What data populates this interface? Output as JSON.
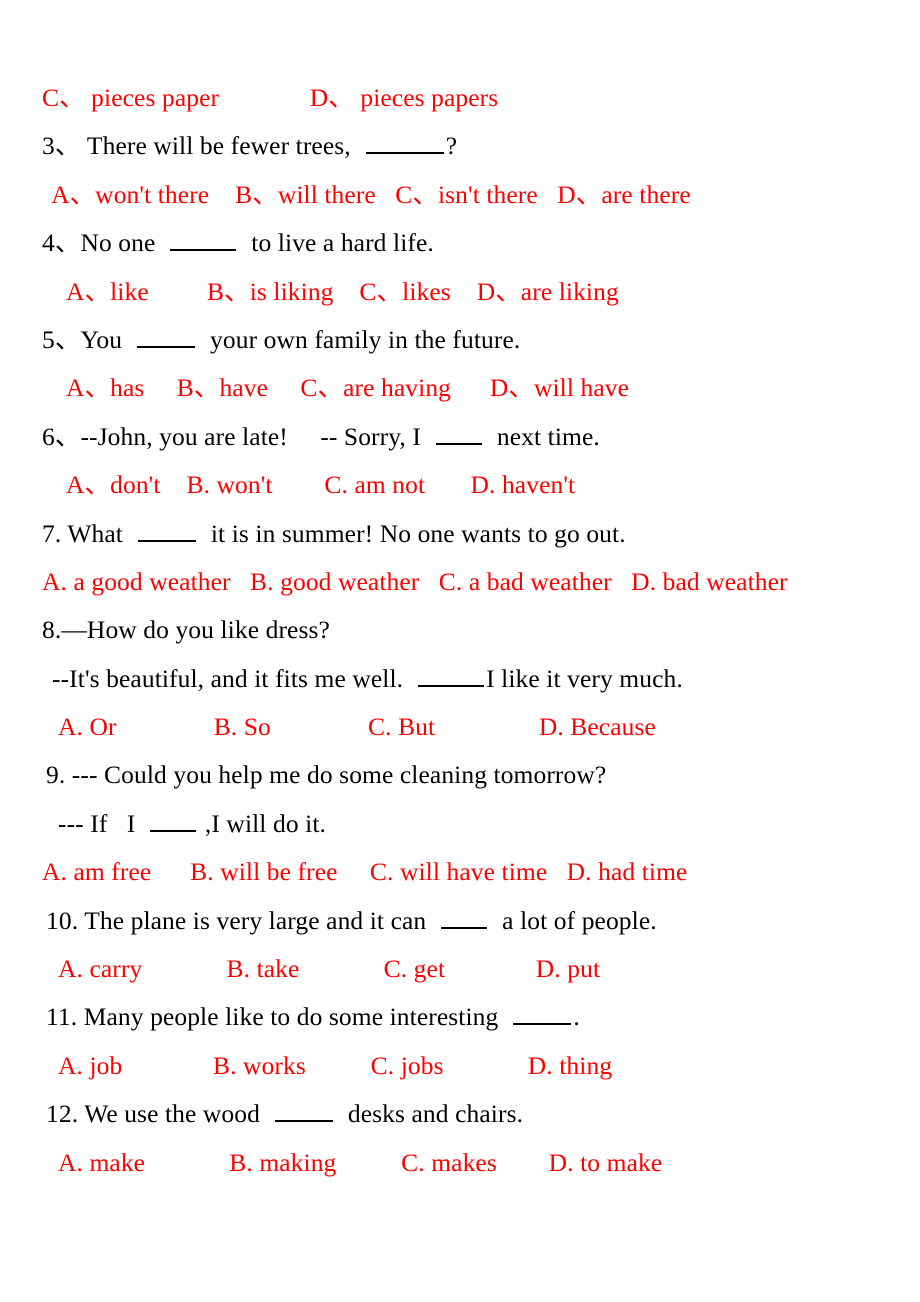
{
  "document": {
    "type": "multiple-choice-worksheet",
    "subject": "English grammar",
    "question_text_color": "#000000",
    "option_text_color": "#ff0000",
    "background_color": "#ffffff"
  },
  "lines": [
    {
      "id": "q2-options-cd",
      "kind": "options",
      "indent": 0,
      "text": "C、 pieces paper              D、 pieces papers"
    },
    {
      "id": "q3-stem",
      "kind": "question",
      "indent": 0,
      "number": "3、",
      "text_before": "3、 There will be fewer trees,  ",
      "blank": "xl",
      "text_after": "?"
    },
    {
      "id": "q3-options",
      "kind": "options",
      "indent": 1,
      "text": " A、won't there    B、will there   C、isn't there   D、are there"
    },
    {
      "id": "q4-stem",
      "kind": "question",
      "indent": 0,
      "number": "4、",
      "text_before": "4、No one  ",
      "blank": "lg",
      "text_after": "  to live a hard life."
    },
    {
      "id": "q4-options",
      "kind": "options",
      "indent": 4,
      "text": "A、like         B、is liking    C、likes    D、are liking"
    },
    {
      "id": "q5-stem",
      "kind": "question",
      "indent": 0,
      "number": "5、",
      "text_before": "5、You  ",
      "blank": "md",
      "text_after": "  your own family in the future."
    },
    {
      "id": "q5-options",
      "kind": "options",
      "indent": 4,
      "text": "A、has     B、have     C、are having      D、will have"
    },
    {
      "id": "q6-stem",
      "kind": "question",
      "indent": 0,
      "number": "6、",
      "text_before": "6、--John, you are late!     -- Sorry, I  ",
      "blank": "sm",
      "text_after": "  next time."
    },
    {
      "id": "q6-options",
      "kind": "options",
      "indent": 4,
      "text": "A、don't    B. won't        C. am not       D. haven't"
    },
    {
      "id": "q7-stem",
      "kind": "question",
      "indent": 0,
      "number": "7.",
      "text_before": "7. What  ",
      "blank": "md",
      "text_after": "  it is in summer! No one wants to go out."
    },
    {
      "id": "q7-options",
      "kind": "options",
      "indent": 0,
      "text": "A. a good weather   B. good weather   C. a bad weather   D. bad weather"
    },
    {
      "id": "q8-stem-1",
      "kind": "question",
      "indent": 0,
      "number": "8.",
      "text_before": "8.—How do you like dress?",
      "blank": null,
      "text_after": ""
    },
    {
      "id": "q8-stem-2",
      "kind": "question",
      "indent": 2,
      "text_before": "--It's beautiful, and it fits me well.  ",
      "blank": "lg",
      "text_after": "I like it very much."
    },
    {
      "id": "q8-options",
      "kind": "options",
      "indent": 3,
      "text": "A. Or               B. So               C. But                D. Because"
    },
    {
      "id": "q9-stem-1",
      "kind": "question",
      "indent": 1,
      "number": "9.",
      "text_before": "9. --- Could you help me do some cleaning tomorrow?",
      "blank": null,
      "text_after": ""
    },
    {
      "id": "q9-stem-2",
      "kind": "question",
      "indent": 3,
      "text_before": "--- If   I  ",
      "blank": "sm",
      "text_after": " ,I will do it."
    },
    {
      "id": "q9-options",
      "kind": "options",
      "indent": 0,
      "text": "A. am free      B. will be free     C. will have time   D. had time"
    },
    {
      "id": "q10-stem",
      "kind": "question",
      "indent": 1,
      "number": "10.",
      "text_before": "10. The plane is very large and it can  ",
      "blank": "sm",
      "text_after": "  a lot of people."
    },
    {
      "id": "q10-options",
      "kind": "options",
      "indent": 3,
      "text": "A. carry             B. take             C. get              D. put"
    },
    {
      "id": "q11-stem",
      "kind": "question",
      "indent": 1,
      "number": "11.",
      "text_before": "11. Many people like to do some interesting  ",
      "blank": "md",
      "text_after": "."
    },
    {
      "id": "q11-options",
      "kind": "options",
      "indent": 3,
      "text": "A. job              B. works          C. jobs             D. thing"
    },
    {
      "id": "q12-stem",
      "kind": "question",
      "indent": 1,
      "number": "12.",
      "text_before": "12. We use the wood  ",
      "blank": "md",
      "text_after": "  desks and chairs."
    },
    {
      "id": "q12-options",
      "kind": "options",
      "indent": 3,
      "text": "A. make             B. making          C. makes        D. to make"
    }
  ]
}
